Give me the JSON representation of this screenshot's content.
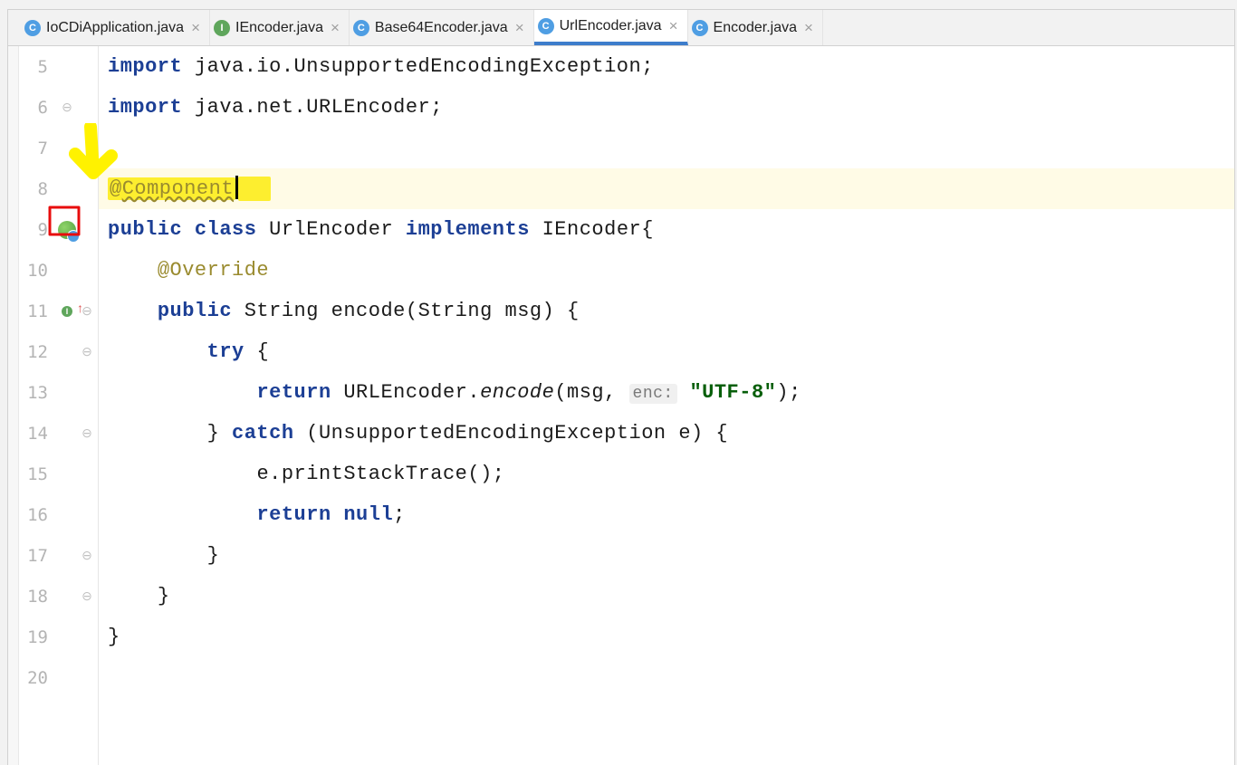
{
  "tabs": [
    {
      "icon": "boot",
      "letter": "C",
      "label": "IoCDiApplication.java",
      "active": false
    },
    {
      "icon": "i",
      "letter": "I",
      "label": "IEncoder.java",
      "active": false
    },
    {
      "icon": "c",
      "letter": "C",
      "label": "Base64Encoder.java",
      "active": false
    },
    {
      "icon": "c",
      "letter": "C",
      "label": "UrlEncoder.java",
      "active": true
    },
    {
      "icon": "c",
      "letter": "C",
      "label": "Encoder.java",
      "active": false
    }
  ],
  "code": {
    "l5": {
      "n": "5",
      "import_kw": "import ",
      "pkg": "java.io.UnsupportedEncodingException;"
    },
    "l6": {
      "n": "6",
      "import_kw": "import ",
      "pkg": "java.net.URLEncoder;"
    },
    "l7": {
      "n": "7"
    },
    "l8": {
      "n": "8",
      "ann_at": "@",
      "ann_name": "Component"
    },
    "l9": {
      "n": "9",
      "kw1": "public ",
      "kw2": "class ",
      "cls": "UrlEncoder ",
      "kw3": "implements ",
      "iface": "IEncoder",
      "brace": "{"
    },
    "l10": {
      "n": "10",
      "ann": "@Override"
    },
    "l11": {
      "n": "11",
      "kw": "public ",
      "ret": "String ",
      "name": "encode",
      "args": "(String msg) {"
    },
    "l12": {
      "n": "12",
      "kw": "try ",
      "brace": "{"
    },
    "l13": {
      "n": "13",
      "kw": "return ",
      "cls": "URLEncoder.",
      "method": "encode",
      "open": "(msg, ",
      "hint": "enc:",
      "str": "\"UTF-8\"",
      "close": ");"
    },
    "l14": {
      "n": "14",
      "close": "} ",
      "kw": "catch ",
      "args": "(UnsupportedEncodingException e) {"
    },
    "l15": {
      "n": "15",
      "stmt": "e.printStackTrace();"
    },
    "l16": {
      "n": "16",
      "kw": "return ",
      "nullkw": "null",
      "semi": ";"
    },
    "l17": {
      "n": "17",
      "brace": "}"
    },
    "l18": {
      "n": "18",
      "brace": "}"
    },
    "l19": {
      "n": "19",
      "brace": "}"
    },
    "l20": {
      "n": "20"
    }
  }
}
